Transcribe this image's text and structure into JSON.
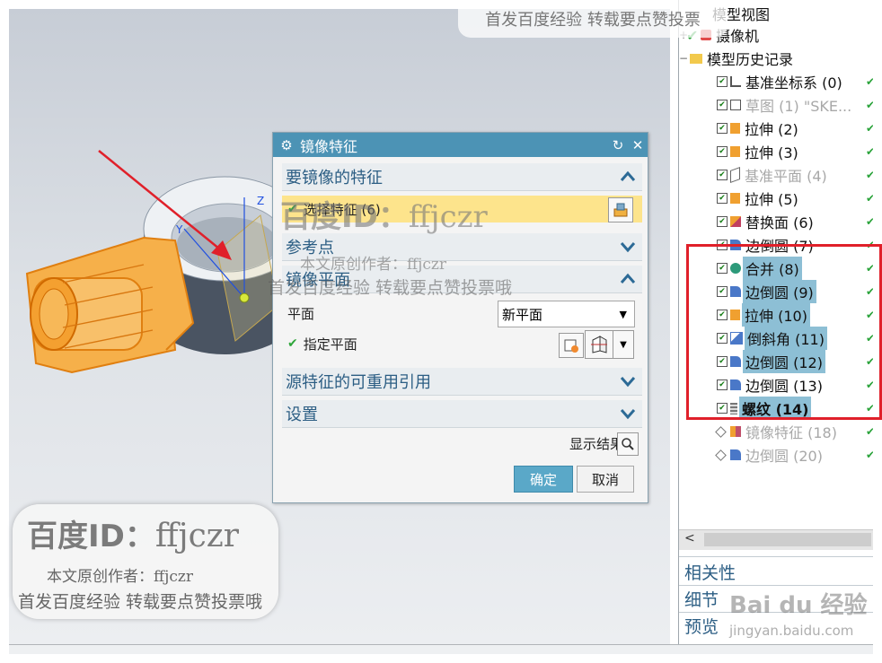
{
  "dialog": {
    "title": "镜像特征",
    "gear_icon": "gear-icon",
    "sections": {
      "features": "要镜像的特征",
      "reference_point": "参考点",
      "mirror_plane": "镜像平面",
      "reusable_refs": "源特征的可重用引用",
      "settings": "设置"
    },
    "select_feature": "选择特征 (6)",
    "plane_label": "平面",
    "plane_value": "新平面",
    "specify_plane": "指定平面",
    "show_result": "显示结果",
    "ok": "确定",
    "cancel": "取消"
  },
  "navigator": {
    "items": [
      {
        "label": "模型视图",
        "check": ""
      },
      {
        "label": "摄像机",
        "check": "✔"
      },
      {
        "label": "模型历史记录",
        "check": ""
      },
      {
        "label": "基准坐标系 (0)",
        "check": "✔"
      },
      {
        "label": "草图 (1) \"SKE...",
        "check": "✔"
      },
      {
        "label": "拉伸 (2)",
        "check": "✔"
      },
      {
        "label": "拉伸 (3)",
        "check": "✔"
      },
      {
        "label": "基准平面 (4)",
        "check": "✔"
      },
      {
        "label": "拉伸 (5)",
        "check": "✔"
      },
      {
        "label": "替换面 (6)",
        "check": "✔"
      },
      {
        "label": "边倒圆 (7)",
        "check": "✔"
      },
      {
        "label": "合并 (8)",
        "check": "✔"
      },
      {
        "label": "边倒圆 (9)",
        "check": "✔"
      },
      {
        "label": "拉伸 (10)",
        "check": "✔"
      },
      {
        "label": "倒斜角 (11)",
        "check": "✔"
      },
      {
        "label": "边倒圆 (12)",
        "check": "✔"
      },
      {
        "label": "边倒圆 (13)",
        "check": "✔"
      },
      {
        "label": "螺纹 (14)",
        "check": "✔"
      },
      {
        "label": "镜像特征 (18)",
        "check": ""
      },
      {
        "label": "边倒圆 (20)",
        "check": ""
      }
    ],
    "panels": [
      "相关性",
      "细节",
      "预览"
    ],
    "scroll_left": "<"
  },
  "watermarks": {
    "top": "首发百度经验  转载要点赞投票",
    "id_prefix": "百度ID：",
    "id_value": "ffjczr",
    "author": "本文原创作者：ffjczr",
    "tagline": "首发百度经验 转载要点赞投票哦",
    "logo": "Bai du 经验",
    "url": "jingyan.baidu.com"
  },
  "colors": {
    "dialog_title_bg": "#4c93b5",
    "section_text": "#2c5e84",
    "ok_button": "#5aa8c8",
    "highlight_row": "#8dbfd5",
    "callout_red": "#e0202a",
    "model_orange": "#f5a028"
  }
}
